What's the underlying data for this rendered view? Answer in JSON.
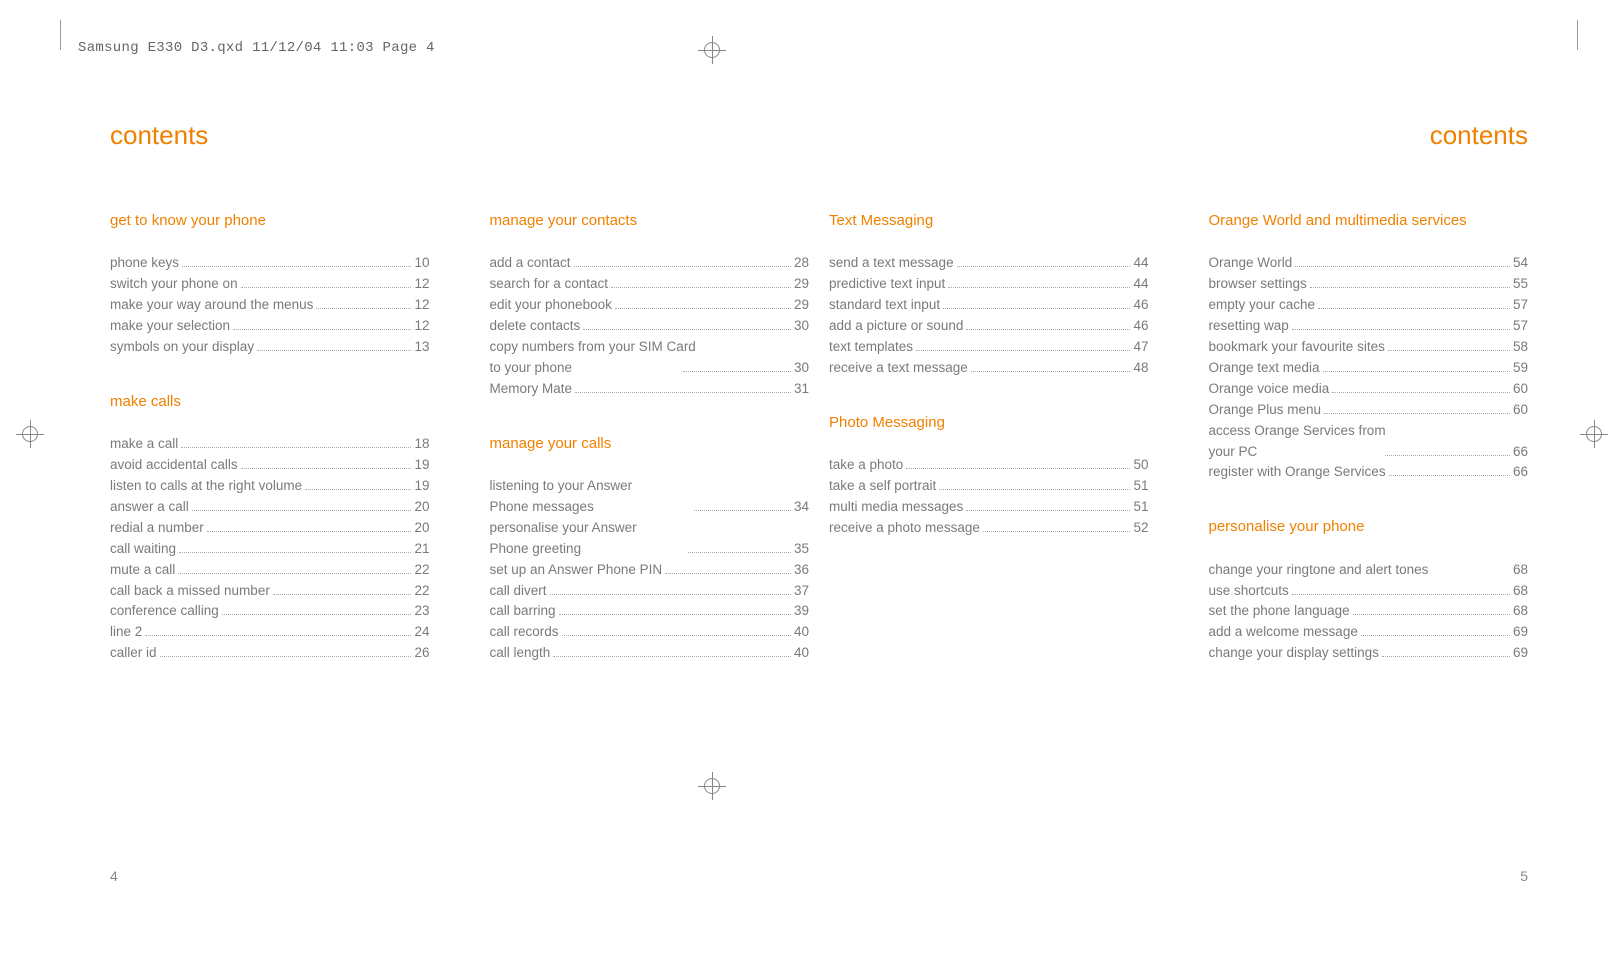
{
  "header_line": "Samsung E330 D3.qxd  11/12/04  11:03  Page 4",
  "running_head_left": "contents",
  "running_head_right": "contents",
  "page_num_left": "4",
  "page_num_right": "5",
  "accent_color": "#f08000",
  "columns": {
    "col1": {
      "sect1": {
        "title": "get to know your phone",
        "entries": [
          {
            "text": "phone keys",
            "page": "10"
          },
          {
            "text": "switch your phone on",
            "page": "12"
          },
          {
            "text": "make your way around the menus",
            "page": "12"
          },
          {
            "text": "make your selection",
            "page": "12"
          },
          {
            "text": "symbols on your display",
            "page": "13"
          }
        ]
      },
      "sect2": {
        "title": "make calls",
        "entries": [
          {
            "text": "make a call",
            "page": "18"
          },
          {
            "text": "avoid accidental calls",
            "page": "19"
          },
          {
            "text": "listen to calls at the right volume",
            "page": "19"
          },
          {
            "text": "answer a call",
            "page": "20"
          },
          {
            "text": "redial a number",
            "page": "20"
          },
          {
            "text": "call waiting",
            "page": "21"
          },
          {
            "text": "mute a call",
            "page": "22"
          },
          {
            "text": "call back a missed number",
            "page": "22"
          },
          {
            "text": "conference calling",
            "page": "23"
          },
          {
            "text": "line 2",
            "page": "24"
          },
          {
            "text": "caller id",
            "page": "26"
          }
        ]
      }
    },
    "col2": {
      "sect1": {
        "title": "manage your contacts",
        "entries": [
          {
            "text": "add a contact",
            "page": "28"
          },
          {
            "text": "search for a contact",
            "page": "29"
          },
          {
            "text": "edit your phonebook",
            "page": "29"
          },
          {
            "text": "delete contacts",
            "page": "30"
          },
          {
            "text": "copy numbers from your SIM Card to your phone",
            "page": "30",
            "wrap": true
          },
          {
            "text": "Memory Mate",
            "page": "31"
          }
        ]
      },
      "sect2": {
        "title": "manage your calls",
        "entries": [
          {
            "text": "listening to your Answer Phone messages",
            "page": "34",
            "wrap": true
          },
          {
            "text": "personalise your Answer Phone greeting",
            "page": "35",
            "wrap": true
          },
          {
            "text": "set up an Answer Phone PIN",
            "page": "36"
          },
          {
            "text": "call divert",
            "page": "37"
          },
          {
            "text": "call barring",
            "page": "39"
          },
          {
            "text": "call records",
            "page": "40"
          },
          {
            "text": "call length",
            "page": "40"
          }
        ]
      }
    },
    "col3": {
      "sect1": {
        "title": "Text Messaging",
        "entries": [
          {
            "text": "send a text message",
            "page": "44"
          },
          {
            "text": "predictive text input",
            "page": "44"
          },
          {
            "text": "standard text input",
            "page": "46"
          },
          {
            "text": "add a picture or sound",
            "page": "46"
          },
          {
            "text": "text templates",
            "page": "47"
          },
          {
            "text": "receive a text message",
            "page": "48"
          }
        ]
      },
      "sect2": {
        "title": "Photo Messaging",
        "entries": [
          {
            "text": "take a photo",
            "page": "50"
          },
          {
            "text": "take a self portrait",
            "page": "51"
          },
          {
            "text": "multi media messages",
            "page": "51"
          },
          {
            "text": "receive a photo message",
            "page": "52"
          }
        ]
      }
    },
    "col4": {
      "sect1": {
        "title": "Orange World and multimedia services",
        "entries": [
          {
            "text": "Orange World",
            "page": "54"
          },
          {
            "text": "browser settings",
            "page": "55"
          },
          {
            "text": "empty your cache",
            "page": "57"
          },
          {
            "text": "resetting wap",
            "page": "57"
          },
          {
            "text": "bookmark your favourite sites",
            "page": "58"
          },
          {
            "text": "Orange text media",
            "page": "59"
          },
          {
            "text": "Orange voice media",
            "page": "60"
          },
          {
            "text": "Orange Plus menu",
            "page": "60"
          },
          {
            "text": "access Orange Services from your PC",
            "page": "66",
            "wrap": true
          },
          {
            "text": "register with Orange Services",
            "page": "66"
          }
        ]
      },
      "sect2": {
        "title": "personalise your phone",
        "entries": [
          {
            "text": "change your ringtone and alert tones",
            "page": "68",
            "nodots": true
          },
          {
            "text": "use shortcuts",
            "page": "68"
          },
          {
            "text": "set the phone language",
            "page": "68"
          },
          {
            "text": "add a welcome message",
            "page": "69"
          },
          {
            "text": "change your display settings",
            "page": "69"
          }
        ]
      }
    }
  }
}
